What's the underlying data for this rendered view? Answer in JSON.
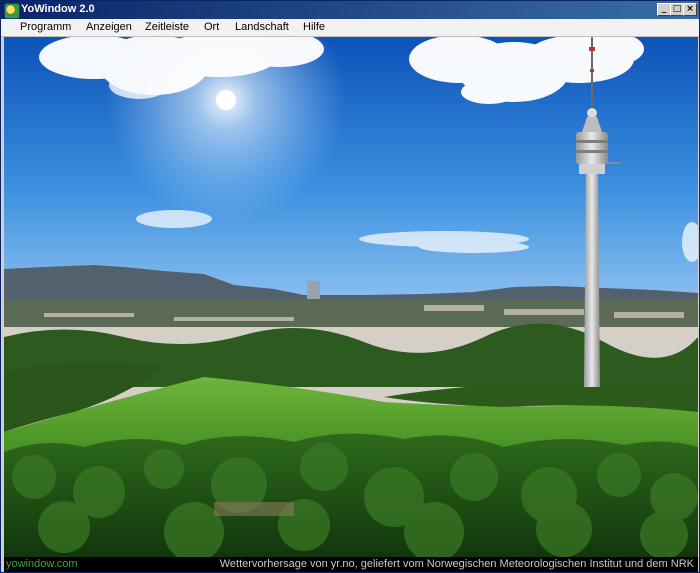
{
  "window": {
    "title": "YoWindow 2.0"
  },
  "title_buttons": {
    "minimize": "_",
    "maximize": "□",
    "close": "×"
  },
  "menu": {
    "items": [
      {
        "label": "Programm"
      },
      {
        "label": "Anzeigen"
      },
      {
        "label": "Zeitleiste"
      },
      {
        "label": "Ort"
      },
      {
        "label": "Landschaft"
      },
      {
        "label": "Hilfe"
      }
    ]
  },
  "scene": {
    "description_icons": [
      "sun-icon",
      "cloud-icon",
      "tower-icon"
    ],
    "sky_top": "#0c52b8",
    "sky_bottom": "#7fbaf0",
    "meadow": "#4e9b2a",
    "forest": "#1f4f14"
  },
  "status": {
    "left": "yowindow.com",
    "right": "Wettervorhersage von yr.no, geliefert vom Norwegischen Meteorologischen Institut und dem NRK"
  }
}
